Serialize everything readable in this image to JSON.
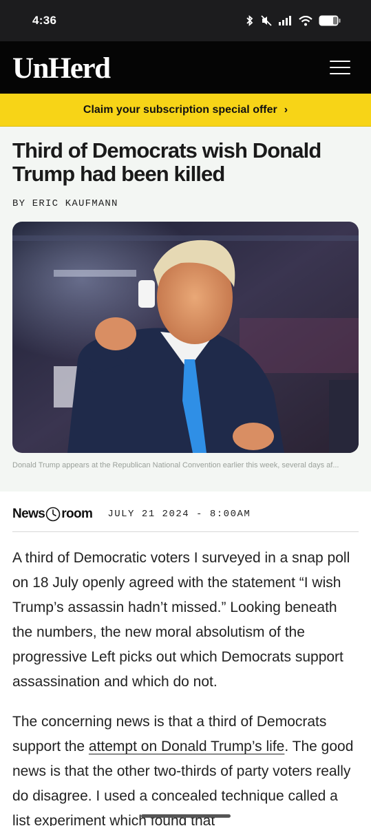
{
  "status_bar": {
    "time": "4:36"
  },
  "header": {
    "logo": "UnHerd"
  },
  "promo": {
    "text": "Claim your subscription special offer",
    "arrow": "›"
  },
  "article": {
    "title": "Third of Democrats wish Donald Trump had been killed",
    "byline": "BY ERIC KAUFMANN",
    "image_caption": "Donald Trump appears at the Republican National Convention earlier this week, several days af...",
    "section_part1": "News",
    "section_part2": "room",
    "date": "JULY 21 2024 - 8:00AM",
    "para1": "A third of Democratic voters I surveyed in a snap poll on 18 July openly agreed with the statement “I wish Trump’s assassin hadn’t missed.” Looking beneath the numbers, the new moral absolutism of the progressive Left picks out which Democrats support assassination and which do not.",
    "para2_a": "The concerning news is that a third of Democrats support the ",
    "para2_link1": "attempt on Donald Trump’s life",
    "para2_b": ". The good news is that the other two-thirds of party voters really do disagree. I used a concealed technique called a ",
    "para2_link2": "list experiment",
    "para2_c": " which found that"
  },
  "colors": {
    "promo": "#f7d417",
    "header": "#050505",
    "tie": "#2f8fe6"
  }
}
